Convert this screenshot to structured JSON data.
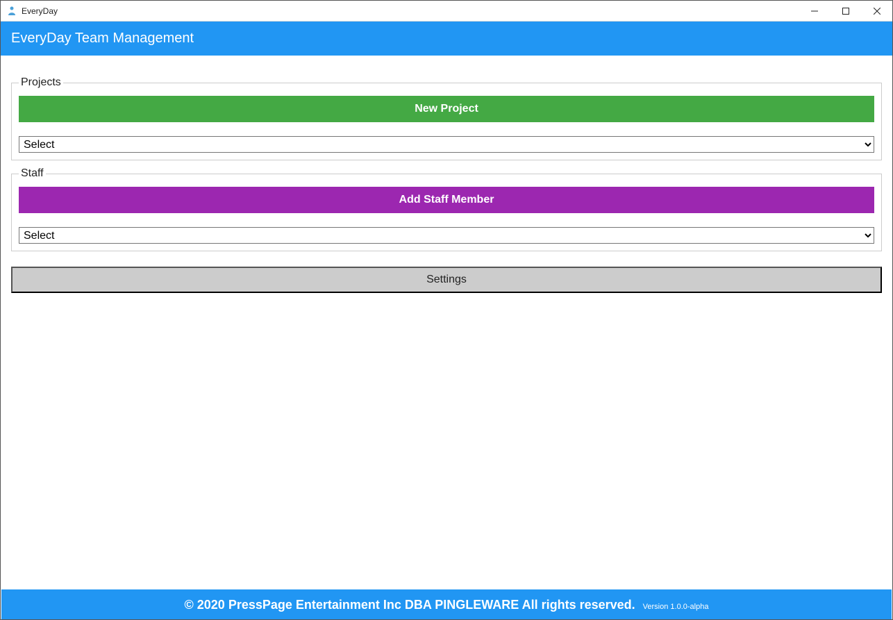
{
  "window": {
    "title": "EveryDay"
  },
  "header": {
    "title": "EveryDay Team Management"
  },
  "projects": {
    "legend": "Projects",
    "button_label": "New Project",
    "select_value": "Select"
  },
  "staff": {
    "legend": "Staff",
    "button_label": "Add Staff Member",
    "select_value": "Select"
  },
  "settings": {
    "label": "Settings"
  },
  "footer": {
    "copyright": "© 2020 PressPage Entertainment Inc DBA PINGLEWARE  All rights reserved.",
    "version": "Version 1.0.0-alpha"
  },
  "colors": {
    "accent_blue": "#2196F3",
    "button_green": "#44a944",
    "button_purple": "#9c27b0",
    "button_grey": "#cccccc"
  }
}
